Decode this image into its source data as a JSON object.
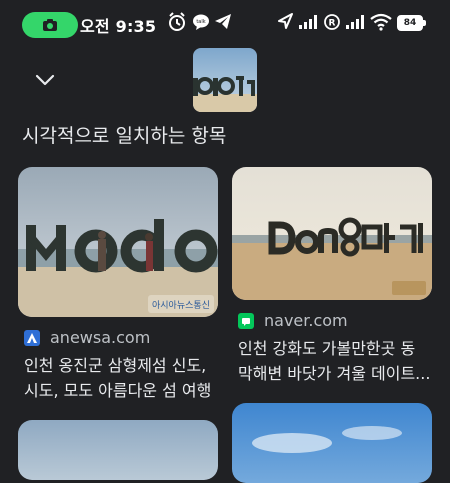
{
  "status_bar": {
    "time": "오전 9:35",
    "battery": "84",
    "icons": [
      "screen-record-icon",
      "alarm-icon",
      "talk-icon",
      "telegram-icon",
      "location-icon",
      "signal-icon",
      "roaming-icon",
      "signal-icon",
      "wifi-icon",
      "battery-icon"
    ]
  },
  "header": {
    "collapse_icon": "chevron-down-icon",
    "section_title": "시각적으로 일치하는 항목"
  },
  "results": [
    {
      "source": "anewsa.com",
      "title_line1": "인천 옹진군 삼형제섬 신도,",
      "title_line2": "시도, 모도 아름다운 섬 여행",
      "sculpture_text": "Modo",
      "watermark": "아시아뉴스통신",
      "favicon_color": "#2f6fd6"
    },
    {
      "source": "naver.com",
      "title_line1": "인천 강화도 가볼만한곳 동",
      "title_line2": "막해변 바닷가 겨울 데이트...",
      "sculpture_text": "Dong마기",
      "favicon_color": "#03c75a"
    }
  ],
  "colors": {
    "background": "#202124",
    "accent_green": "#34d66a"
  }
}
